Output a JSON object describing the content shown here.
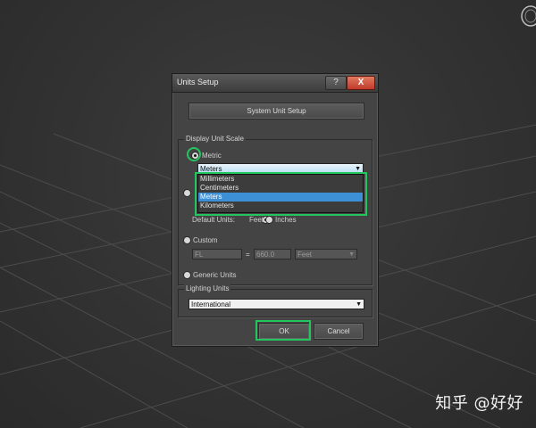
{
  "dialog": {
    "title": "Units Setup",
    "help_label": "?",
    "close_label": "X",
    "system_unit_button": "System Unit Setup",
    "display_unit_scale": {
      "title": "Display Unit Scale",
      "metric_label": "Metric",
      "metric_selected": "Meters",
      "metric_options": [
        "Millimeters",
        "Centimeters",
        "Meters",
        "Kilometers"
      ],
      "default_units_label": "Default Units:",
      "feet_label": "Feet",
      "inches_label": "Inches",
      "custom_label": "Custom",
      "custom_name": "FL",
      "custom_equals": "=",
      "custom_value": "660.0",
      "custom_unit": "Feet",
      "generic_label": "Generic Units"
    },
    "lighting_units": {
      "title": "Lighting Units",
      "value": "International"
    },
    "ok_label": "OK",
    "cancel_label": "Cancel"
  },
  "watermark": "知乎 @好好",
  "colors": {
    "highlight": "#22c55e",
    "selection": "#3d8fd6",
    "dialog_bg": "#444444"
  }
}
